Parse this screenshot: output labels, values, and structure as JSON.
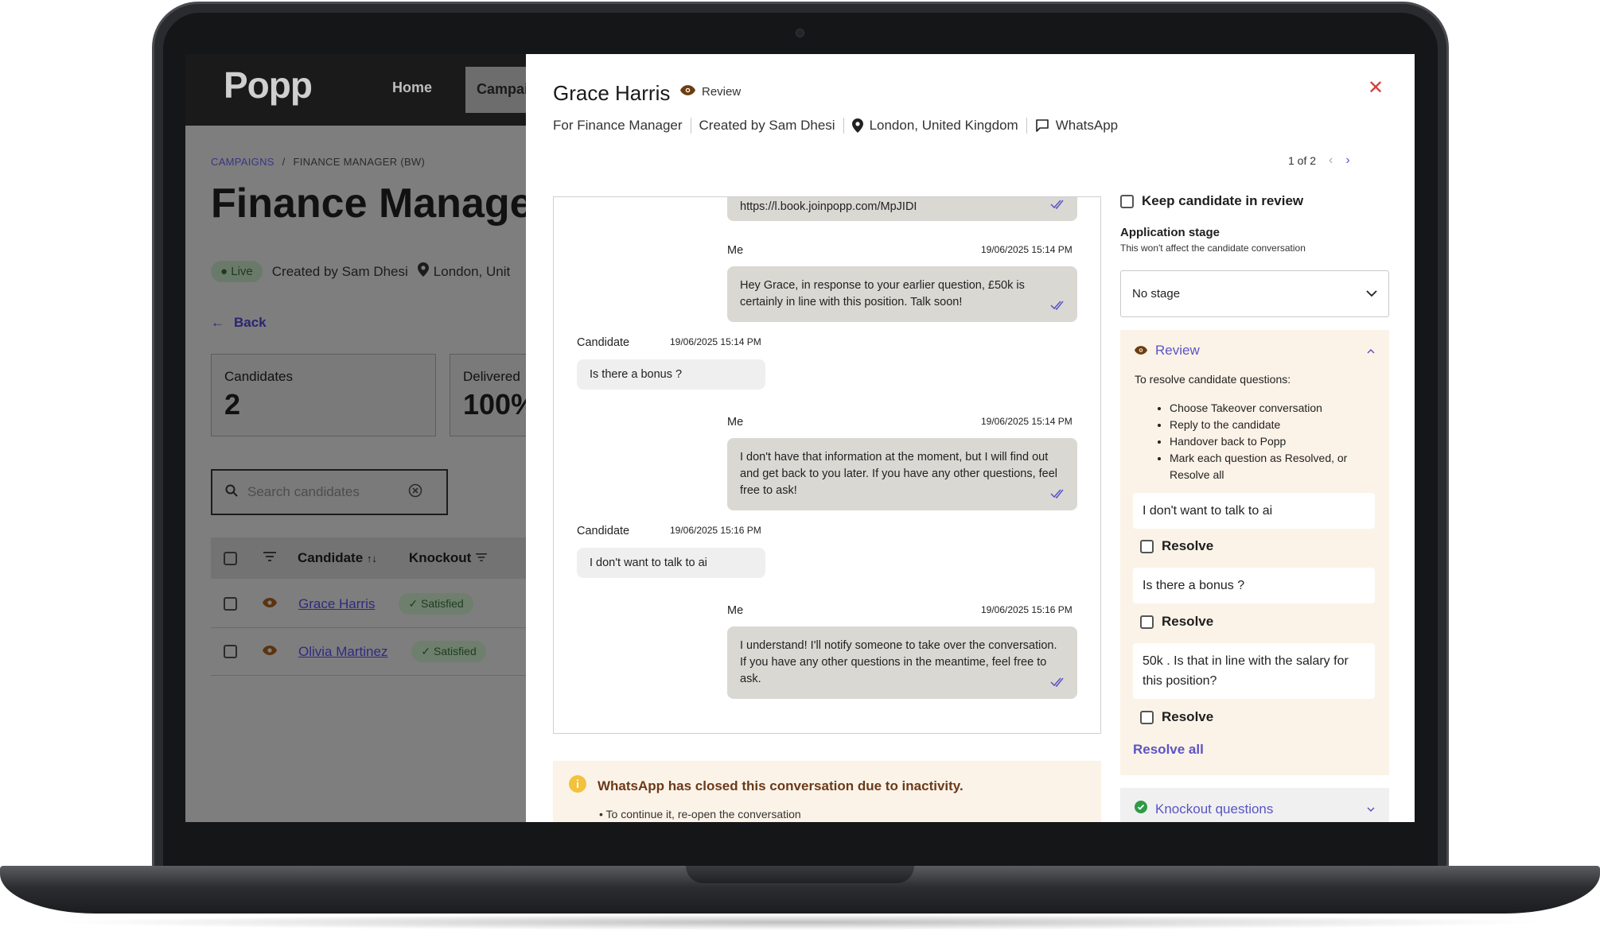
{
  "background_app": {
    "logo": "Popp",
    "nav": {
      "home": "Home",
      "campaigns": "Campai"
    },
    "breadcrumb": {
      "campaigns": "CAMPAIGNS",
      "separator": "/",
      "current": "FINANCE MANAGER (BW)"
    },
    "title": "Finance Manage",
    "status": "Live",
    "created_by": "Created by Sam Dhesi",
    "location": "London, Unit",
    "back": "Back",
    "stats": [
      {
        "label": "Candidates",
        "value": "2"
      },
      {
        "label": "Delivered",
        "value": "100%"
      }
    ],
    "search": {
      "placeholder": "Search candidates"
    },
    "table": {
      "headers": {
        "candidate": "Candidate",
        "knockout": "Knockout"
      },
      "rows": [
        {
          "name": "Grace Harris",
          "knockout": "Satisfied"
        },
        {
          "name": "Olivia Martinez",
          "knockout": "Satisfied"
        }
      ]
    }
  },
  "modal": {
    "candidate_name": "Grace Harris",
    "status_label": "Review",
    "close_icon": "close-icon",
    "meta": {
      "role": "For Finance Manager",
      "created_by": "Created by Sam Dhesi",
      "location": "London, United Kingdom",
      "channel": "WhatsApp"
    },
    "pager": {
      "text": "1 of 2"
    },
    "messages": [
      {
        "from": "me",
        "text": "https://l.book.joinpopp.com/MpJIDI"
      },
      {
        "from": "me",
        "sender": "Me",
        "timestamp": "19/06/2025 15:14 PM",
        "text": "Hey Grace, in response to your earlier question, £50k is certainly in line with this position. Talk soon!"
      },
      {
        "from": "candidate",
        "sender": "Candidate",
        "timestamp": "19/06/2025 15:14 PM",
        "text": "Is there a bonus ?"
      },
      {
        "from": "me",
        "sender": "Me",
        "timestamp": "19/06/2025 15:14 PM",
        "text": "I don't have that information at the moment, but I will find out and get back to you later. If you have any other questions, feel free to ask!"
      },
      {
        "from": "candidate",
        "sender": "Candidate",
        "timestamp": "19/06/2025 15:16 PM",
        "text": "I don't want to talk to ai"
      },
      {
        "from": "me",
        "sender": "Me",
        "timestamp": "19/06/2025 15:16 PM",
        "text": "I understand! I'll notify someone to take over the conversation. If you have any other questions in the meantime, feel free to ask."
      }
    ],
    "notice": {
      "title": "WhatsApp has closed this conversation due to inactivity.",
      "subtitle": "• To continue it, re-open the conversation"
    },
    "sidebar": {
      "keep_in_review": "Keep candidate in review",
      "application_stage": {
        "label": "Application stage",
        "hint": "This won't affect the candidate conversation",
        "selected": "No stage"
      },
      "review": {
        "title": "Review",
        "intro": "To resolve candidate questions:",
        "steps": [
          "Choose Takeover conversation",
          "Reply to the candidate",
          "Handover back to Popp",
          "Mark each question as Resolved, or Resolve all"
        ],
        "questions": [
          "I don't want to talk to ai",
          "Is there a bonus ?",
          "50k . Is that in line with the salary for this position?"
        ],
        "resolve_label": "Resolve",
        "resolve_all": "Resolve all"
      },
      "knockout": {
        "title": "Knockout questions"
      }
    }
  },
  "colors": {
    "accent": "#5a54c4",
    "close": "#d83b3b",
    "review_panel_bg": "#fcf3e8",
    "bubble_me": "#dad8d3",
    "bubble_candidate": "#efefef",
    "notice_icon": "#f2c23d",
    "knockout_check": "#2e9b46"
  }
}
